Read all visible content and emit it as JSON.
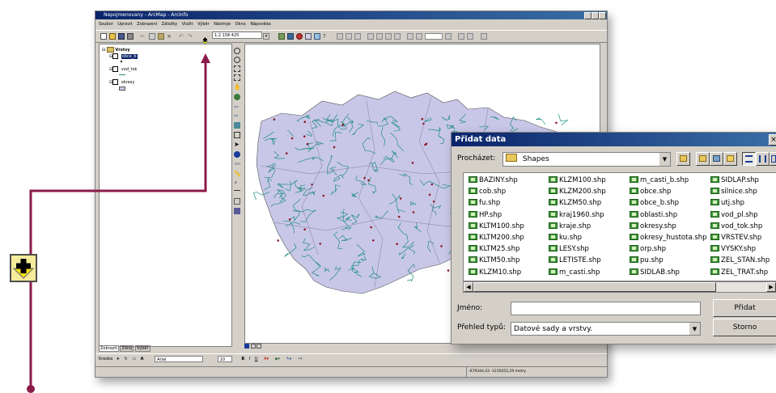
{
  "arcmap": {
    "title": "Nepojmenovany - ArcMap - ArcInfo",
    "menu": [
      "Soubor",
      "Upravit",
      "Zobrazení",
      "Záložky",
      "Vložit",
      "Výběr",
      "Nástroje",
      "Okno",
      "Nápověda"
    ],
    "scale": "1:2 158 425",
    "toc": {
      "root": "Vrstvy",
      "layers": [
        "obce_b",
        "vod_tok",
        "okresy"
      ]
    },
    "toc_tabs": [
      "Zobrazit",
      "Zdroj",
      "Výběr"
    ],
    "draw_label": "Kresba",
    "font_name": "Arial",
    "font_size": "10",
    "status_coords": "-679344,43  -1235052,29 metry"
  },
  "dialog": {
    "title": "Přidat data",
    "look_in_label": "Procházet:",
    "look_in_value": "Shapes",
    "files": [
      [
        "BAZINY.shp",
        "cob.shp",
        "fu.shp",
        "HP.shp",
        "KLTM100.shp",
        "KLTM200.shp",
        "KLTM25.shp",
        "KLTM50.shp",
        "KLZM10.shp"
      ],
      [
        "KLZM100.shp",
        "KLZM200.shp",
        "KLZM50.shp",
        "kraj1960.shp",
        "kraje.shp",
        "ku.shp",
        "LESY.shp",
        "LETISTE.shp",
        "m_casti.shp"
      ],
      [
        "m_casti_b.shp",
        "obce.shp",
        "obce_b.shp",
        "oblasti.shp",
        "okresy.shp",
        "okresy_hustota.shp",
        "orp.shp",
        "pu.shp",
        "SIDLAB.shp"
      ],
      [
        "SIDLAP.shp",
        "silnice.shp",
        "utj.shp",
        "vod_pl.shp",
        "vod_tok.shp",
        "VRSTEV.shp",
        "VYSKY.shp",
        "ZEL_STAN.shp",
        "ZEL_TRAT.shp"
      ]
    ],
    "name_label": "Jméno:",
    "name_value": "",
    "types_label": "Přehled typů:",
    "types_value": "Datové sady a vrstvy.",
    "add_button": "Přidat",
    "cancel_button": "Storno"
  },
  "colors": {
    "annotation_line": "#8b1b4a",
    "title_bar": "#0a246a",
    "map_fill": "#c9c7e8",
    "rivers": "#1e8e7e"
  }
}
